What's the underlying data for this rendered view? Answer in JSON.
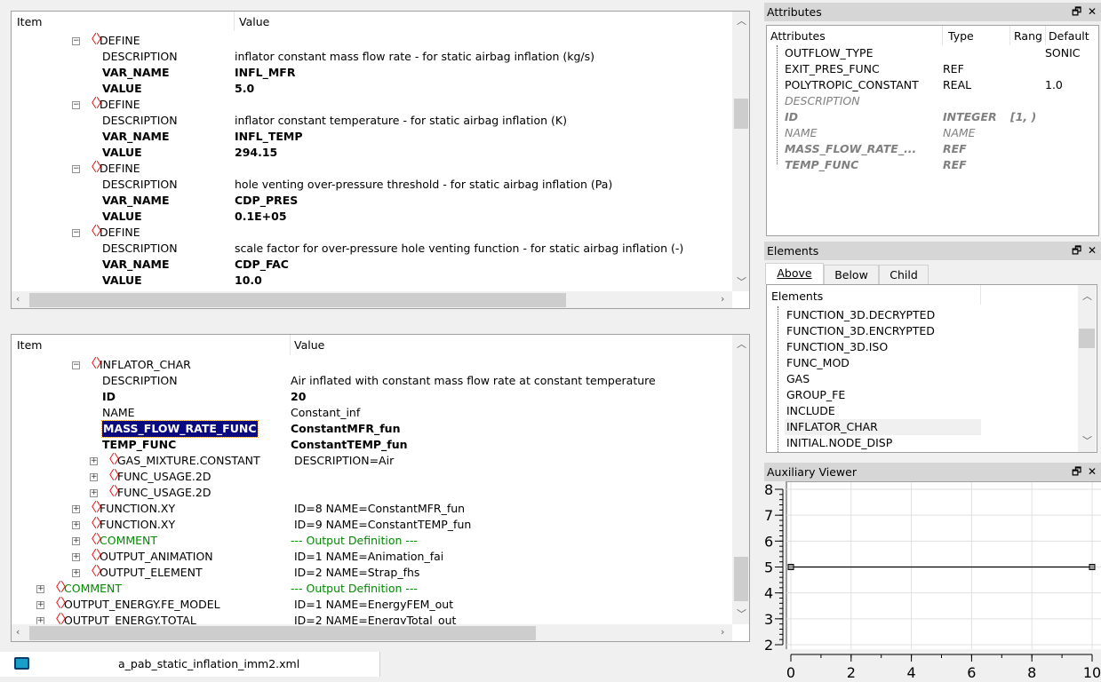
{
  "top_tree": {
    "col_item": "Item",
    "col_value": "Value",
    "rows": [
      {
        "label": "DEFINE",
        "value": "",
        "level": 3,
        "node": "element",
        "expander": "minus"
      },
      {
        "label": "DESCRIPTION",
        "value": "inflator constant mass flow rate - for static airbag inflation (kg/s)",
        "level": 4,
        "node": "attr"
      },
      {
        "label": "VAR_NAME",
        "value": "INFL_MFR",
        "level": 4,
        "node": "attr",
        "bold": true
      },
      {
        "label": "VALUE",
        "value": "5.0",
        "level": 4,
        "node": "attr",
        "bold": true
      },
      {
        "label": "DEFINE",
        "value": "",
        "level": 3,
        "node": "element",
        "expander": "minus"
      },
      {
        "label": "DESCRIPTION",
        "value": "inflator constant temperature - for static airbag inflation (K)",
        "level": 4,
        "node": "attr"
      },
      {
        "label": "VAR_NAME",
        "value": "INFL_TEMP",
        "level": 4,
        "node": "attr",
        "bold": true
      },
      {
        "label": "VALUE",
        "value": "294.15",
        "level": 4,
        "node": "attr",
        "bold": true
      },
      {
        "label": "DEFINE",
        "value": "",
        "level": 3,
        "node": "element",
        "expander": "minus"
      },
      {
        "label": "DESCRIPTION",
        "value": "hole venting over-pressure threshold - for static airbag inflation (Pa)",
        "level": 4,
        "node": "attr"
      },
      {
        "label": "VAR_NAME",
        "value": "CDP_PRES",
        "level": 4,
        "node": "attr",
        "bold": true
      },
      {
        "label": "VALUE",
        "value": "0.1E+05",
        "level": 4,
        "node": "attr",
        "bold": true
      },
      {
        "label": "DEFINE",
        "value": "",
        "level": 3,
        "node": "element",
        "expander": "minus"
      },
      {
        "label": "DESCRIPTION",
        "value": "scale factor for over-pressure hole venting function - for static airbag inflation (-)",
        "level": 4,
        "node": "attr"
      },
      {
        "label": "VAR_NAME",
        "value": "CDP_FAC",
        "level": 4,
        "node": "attr",
        "bold": true
      },
      {
        "label": "VALUE",
        "value": "10.0",
        "level": 4,
        "node": "attr",
        "bold": true
      }
    ]
  },
  "bottom_tree": {
    "col_item": "Item",
    "col_value": "Value",
    "rows": [
      {
        "label": "INFLATOR_CHAR",
        "value": "",
        "level": 3,
        "node": "element",
        "expander": "minus"
      },
      {
        "label": "DESCRIPTION",
        "value": "Air inflated with constant mass flow rate at constant temperature",
        "level": 4,
        "node": "attr"
      },
      {
        "label": "ID",
        "value": "20",
        "level": 4,
        "node": "attr",
        "bold": true
      },
      {
        "label": "NAME",
        "value": "Constant_inf",
        "level": 4,
        "node": "attr"
      },
      {
        "label": "MASS_FLOW_RATE_FUNC",
        "value": "ConstantMFR_fun",
        "level": 4,
        "node": "attr",
        "bold": true,
        "selected": true
      },
      {
        "label": "TEMP_FUNC",
        "value": "ConstantTEMP_fun",
        "level": 4,
        "node": "attr",
        "bold": true
      },
      {
        "label": "GAS_MIXTURE.CONSTANT",
        "value": " DESCRIPTION=Air",
        "level": 4,
        "node": "element",
        "expander": "plus"
      },
      {
        "label": "FUNC_USAGE.2D",
        "value": "",
        "level": 4,
        "node": "element",
        "expander": "plus"
      },
      {
        "label": "FUNC_USAGE.2D",
        "value": "",
        "level": 4,
        "node": "element",
        "expander": "plus"
      },
      {
        "label": "FUNCTION.XY",
        "value": " ID=8 NAME=ConstantMFR_fun",
        "level": 3,
        "node": "element",
        "expander": "plus"
      },
      {
        "label": "FUNCTION.XY",
        "value": " ID=9 NAME=ConstantTEMP_fun",
        "level": 3,
        "node": "element",
        "expander": "plus"
      },
      {
        "label": "COMMENT",
        "value": "--- Output Definition ---",
        "level": 3,
        "node": "element",
        "expander": "plus",
        "comment": true
      },
      {
        "label": "OUTPUT_ANIMATION",
        "value": " ID=1 NAME=Animation_fai",
        "level": 3,
        "node": "element",
        "expander": "plus"
      },
      {
        "label": "OUTPUT_ELEMENT",
        "value": " ID=2 NAME=Strap_fhs",
        "level": 3,
        "node": "element",
        "expander": "plus"
      },
      {
        "label": "COMMENT",
        "value": "--- Output Definition ---",
        "level": 1,
        "node": "element",
        "expander": "plus",
        "comment": true
      },
      {
        "label": "OUTPUT_ENERGY.FE_MODEL",
        "value": " ID=1 NAME=EnergyFEM_out",
        "level": 1,
        "node": "element",
        "expander": "plus"
      },
      {
        "label": "OUTPUT_ENERGY.TOTAL",
        "value": " ID=2 NAME=EnergyTotal_out",
        "level": 1,
        "node": "element",
        "expander": "plus"
      }
    ]
  },
  "file_tab": {
    "label": "a_pab_static_inflation_imm2.xml",
    "icon": "app-file-icon"
  },
  "attributes_panel": {
    "title": "Attributes",
    "columns": [
      "Attributes",
      "Type",
      "Rang",
      "Default"
    ],
    "rows": [
      {
        "name": "OUTFLOW_TYPE",
        "type": "",
        "range": "",
        "default": "SONIC"
      },
      {
        "name": "EXIT_PRES_FUNC",
        "type": "REF",
        "range": "",
        "default": ""
      },
      {
        "name": "POLYTROPIC_CONSTANT",
        "type": "REAL",
        "range": "",
        "default": "1.0"
      },
      {
        "name": "DESCRIPTION",
        "type": "",
        "range": "",
        "default": "",
        "used": true
      },
      {
        "name": "ID",
        "type": "INTEGER",
        "range": "[1, )",
        "default": "",
        "used": true,
        "bold": true
      },
      {
        "name": "NAME",
        "type": "NAME",
        "range": "",
        "default": "",
        "used": true
      },
      {
        "name": "MASS_FLOW_RATE_...",
        "type": "REF",
        "range": "",
        "default": "",
        "used": true,
        "bold": true
      },
      {
        "name": "TEMP_FUNC",
        "type": "REF",
        "range": "",
        "default": "",
        "used": true,
        "bold": true
      }
    ]
  },
  "elements_panel": {
    "title": "Elements",
    "tabs": [
      {
        "label": "Above",
        "active": true
      },
      {
        "label": "Below"
      },
      {
        "label": "Child"
      }
    ],
    "column": "Elements",
    "items": [
      "FUNCTION_3D.DECRYPTED",
      "FUNCTION_3D.ENCRYPTED",
      "FUNCTION_3D.ISO",
      "FUNC_MOD",
      "GAS",
      "GROUP_FE",
      "INCLUDE",
      "INFLATOR_CHAR",
      "INITIAL.NODE_DISP"
    ],
    "highlighted": "INFLATOR_CHAR"
  },
  "aux_viewer": {
    "title": "Auxiliary Viewer"
  },
  "colors": {
    "selection": "#0a0a80",
    "element_bracket": "#e01010",
    "comment": "#008a00",
    "title_bar": "#d6d6d6"
  },
  "chart_data": {
    "type": "line",
    "x": [
      0,
      10
    ],
    "series": [
      {
        "values": [
          5,
          5
        ]
      }
    ],
    "xlim": [
      0,
      10
    ],
    "ylim": [
      2,
      8
    ],
    "xticks": [
      "0",
      "2",
      "4",
      "6",
      "8",
      "10"
    ],
    "yticks": [
      "2",
      "3",
      "4",
      "5",
      "6",
      "7",
      "8"
    ],
    "grid": true,
    "markers": "square"
  }
}
